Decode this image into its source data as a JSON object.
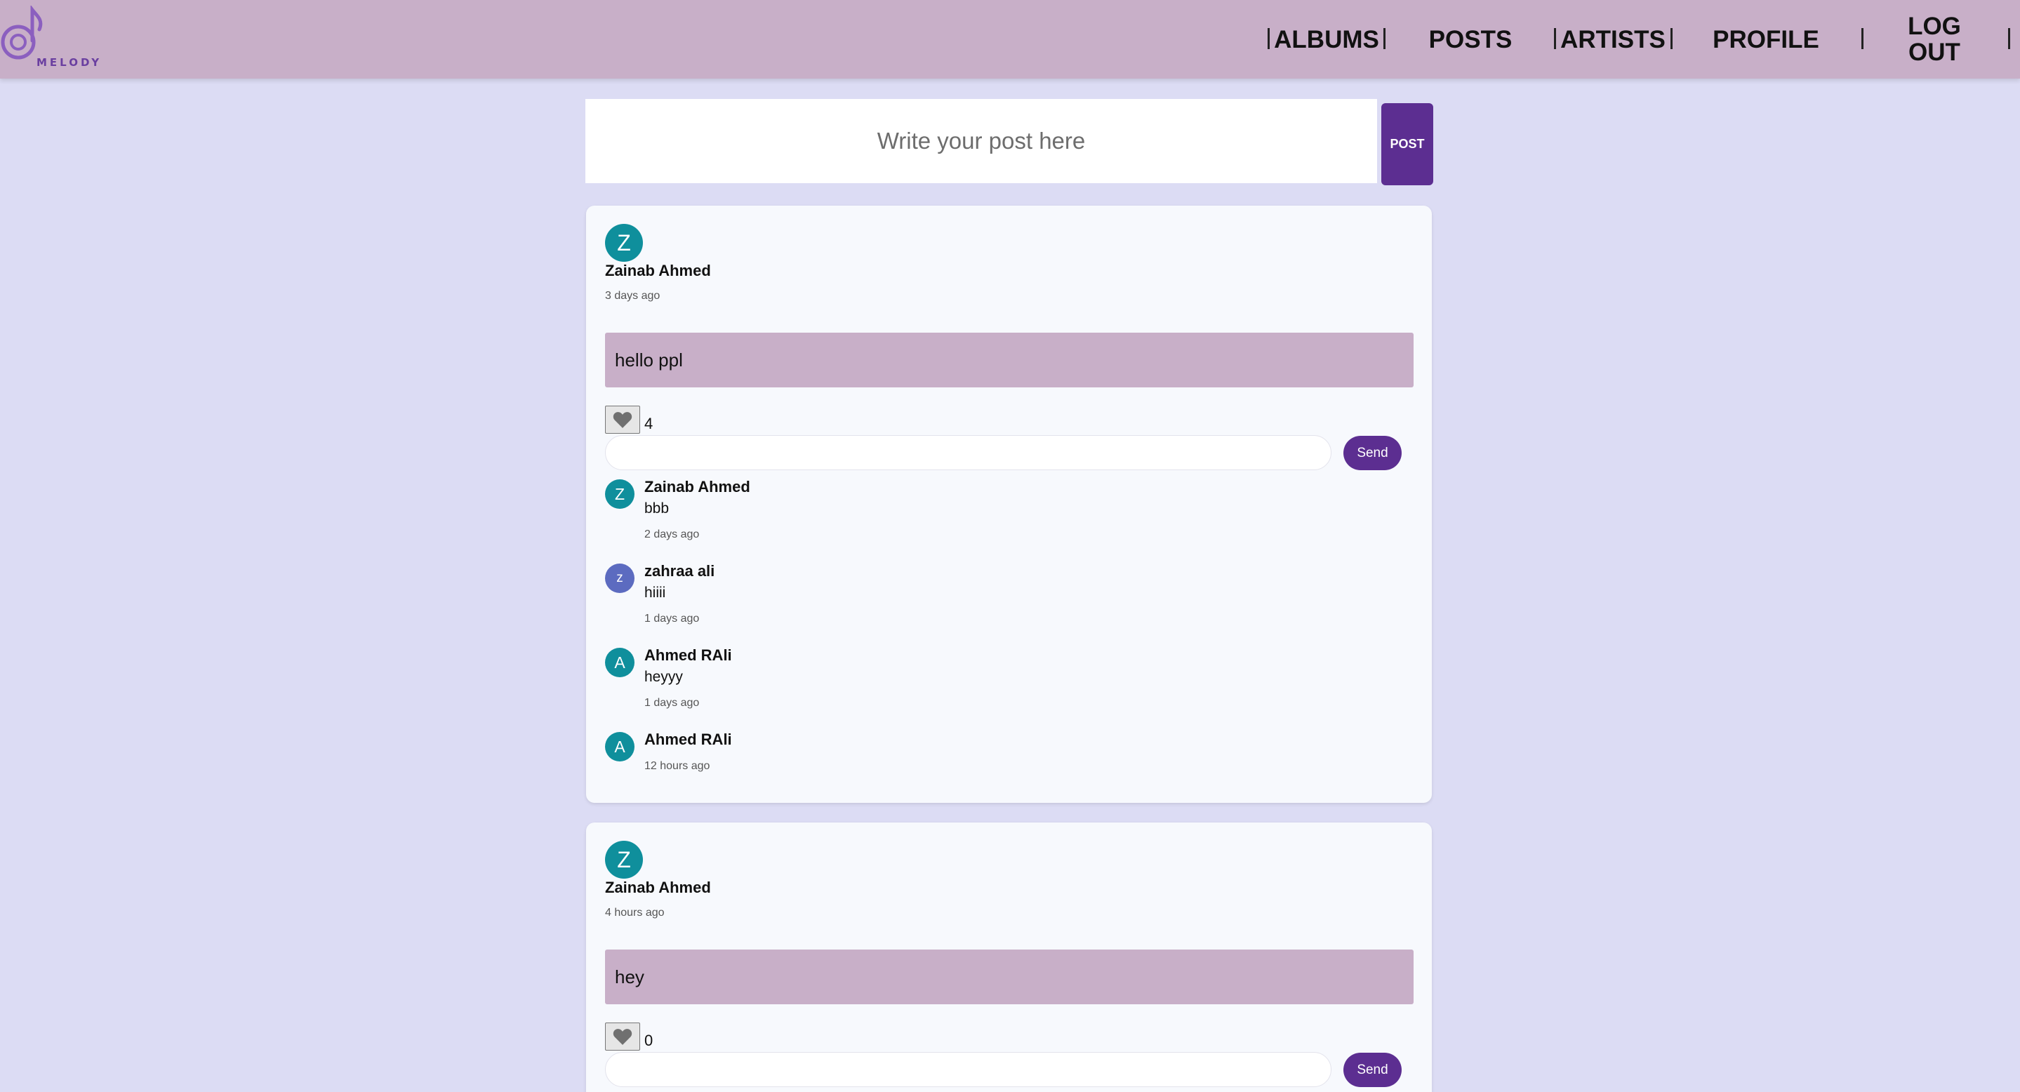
{
  "nav": {
    "logo_text": "MELODY",
    "links": [
      "ALBUMS",
      "POSTS",
      "ARTISTS",
      "PROFILE",
      "LOG OUT"
    ]
  },
  "composer": {
    "placeholder": "Write your post here",
    "button": "POST"
  },
  "posts": [
    {
      "avatar": "Z",
      "author": "Zainab Ahmed",
      "time": "3 days ago",
      "content": "hello ppl",
      "likes": "4",
      "send_label": "Send",
      "comments": [
        {
          "avatar": "Z",
          "author": "Zainab Ahmed",
          "text": "bbb",
          "time": "2 days ago"
        },
        {
          "avatar": "z",
          "author": "zahraa ali",
          "text": "hiiii",
          "time": "1 days ago"
        },
        {
          "avatar": "A",
          "author": "Ahmed RAli",
          "text": "heyyy",
          "time": "1 days ago"
        },
        {
          "avatar": "A",
          "author": "Ahmed RAli",
          "text": "",
          "time": "12 hours ago"
        }
      ]
    },
    {
      "avatar": "Z",
      "author": "Zainab Ahmed",
      "time": "4 hours ago",
      "content": "hey",
      "likes": "0",
      "send_label": "Send",
      "comments": []
    }
  ],
  "colors": {
    "page_bg": "#dcdcf4",
    "navbar": "#c8afc8",
    "accent": "#5c2e91",
    "avatar_teal": "#0f8f9c",
    "avatar_indigo": "#5c6bc0"
  },
  "icons": {
    "like": "heart-icon",
    "logo": "music-note-icon"
  }
}
